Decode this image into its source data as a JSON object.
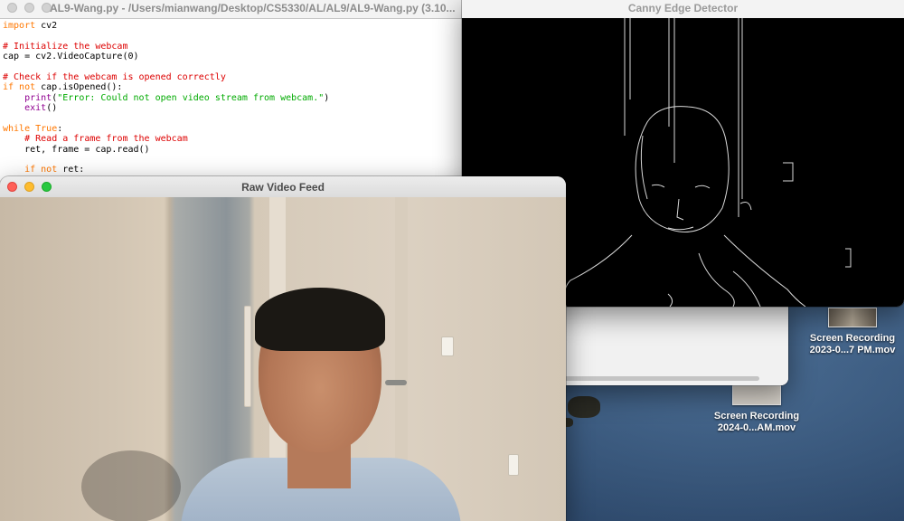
{
  "editor": {
    "title": "AL9-Wang.py - /Users/mianwang/Desktop/CS5330/AL/AL9/AL9-Wang.py (3.10...",
    "lines": [
      {
        "parts": [
          {
            "t": "import",
            "c": "kw"
          },
          {
            "t": " cv2",
            "c": ""
          }
        ]
      },
      {
        "parts": [
          {
            "t": "",
            "c": ""
          }
        ]
      },
      {
        "parts": [
          {
            "t": "# Initialize the webcam",
            "c": "cm"
          }
        ]
      },
      {
        "parts": [
          {
            "t": "cap = cv2.VideoCapture(0)",
            "c": ""
          }
        ]
      },
      {
        "parts": [
          {
            "t": "",
            "c": ""
          }
        ]
      },
      {
        "parts": [
          {
            "t": "# Check if the webcam is opened correctly",
            "c": "cm"
          }
        ]
      },
      {
        "parts": [
          {
            "t": "if not",
            "c": "kw"
          },
          {
            "t": " cap.isOpened():",
            "c": ""
          }
        ]
      },
      {
        "parts": [
          {
            "t": "    ",
            "c": ""
          },
          {
            "t": "print",
            "c": "bi"
          },
          {
            "t": "(",
            "c": ""
          },
          {
            "t": "\"Error: Could not open video stream from webcam.\"",
            "c": "st"
          },
          {
            "t": ")",
            "c": ""
          }
        ]
      },
      {
        "parts": [
          {
            "t": "    ",
            "c": ""
          },
          {
            "t": "exit",
            "c": "bi"
          },
          {
            "t": "()",
            "c": ""
          }
        ]
      },
      {
        "parts": [
          {
            "t": "",
            "c": ""
          }
        ]
      },
      {
        "parts": [
          {
            "t": "while",
            "c": "kw"
          },
          {
            "t": " ",
            "c": ""
          },
          {
            "t": "True",
            "c": "kw"
          },
          {
            "t": ":",
            "c": ""
          }
        ]
      },
      {
        "parts": [
          {
            "t": "    ",
            "c": ""
          },
          {
            "t": "# Read a frame from the webcam",
            "c": "cm"
          }
        ]
      },
      {
        "parts": [
          {
            "t": "    ret, frame = cap.read()",
            "c": ""
          }
        ]
      },
      {
        "parts": [
          {
            "t": "",
            "c": ""
          }
        ]
      },
      {
        "parts": [
          {
            "t": "    ",
            "c": ""
          },
          {
            "t": "if not",
            "c": "kw"
          },
          {
            "t": " ret:",
            "c": ""
          }
        ]
      }
    ]
  },
  "canny": {
    "title": "Canny Edge Detector"
  },
  "raw": {
    "title": "Raw Video Feed"
  },
  "desktop": {
    "icons": [
      {
        "line1": "Screen Recording",
        "line2": "2023-0...7 PM.mov"
      },
      {
        "line1": "Screen Recording",
        "line2": "2024-0...AM.mov"
      }
    ]
  }
}
